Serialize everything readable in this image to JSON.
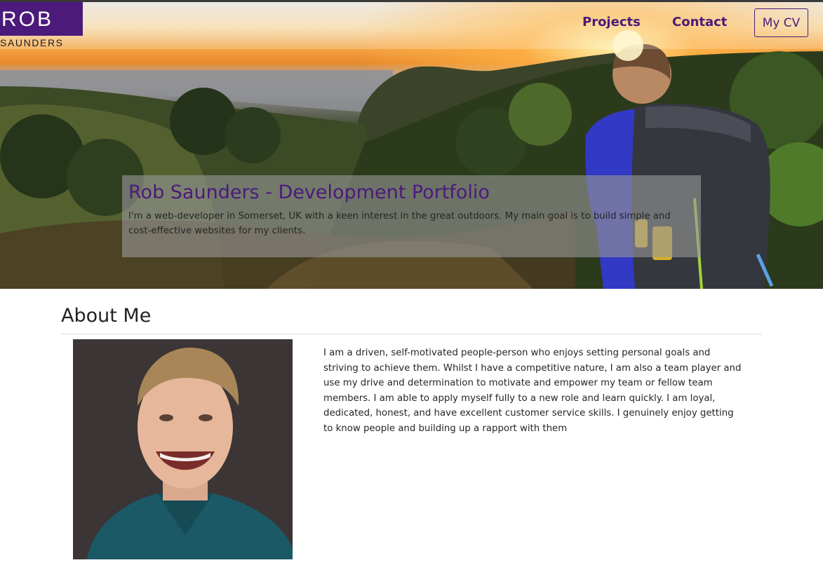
{
  "logo": {
    "line1": "ROB",
    "line2": "SAUNDERS"
  },
  "nav": {
    "projects_label": "Projects",
    "contact_label": "Contact",
    "cv_label": "My CV"
  },
  "hero": {
    "title": "Rob Saunders - Development Portfolio",
    "text": "I'm a web-developer in Somerset, UK with a keen interest in the great outdoors. My main goal is to build simple and cost-effective websites for my clients."
  },
  "about": {
    "heading": "About Me",
    "text": "I am a driven, self-motivated people-person who enjoys setting personal goals and striving to achieve them. Whilst I have a competitive nature, I am also a team player and use my drive and determination to motivate and empower my team or fellow team members. I am able to apply myself fully to a new role and learn quickly. I am loyal, dedicated, honest, and have excellent customer service skills. I genuinely enjoy getting to know people and building up a rapport with them"
  },
  "colors": {
    "brand_purple": "#4b1a7b",
    "text_dark": "#262626"
  }
}
